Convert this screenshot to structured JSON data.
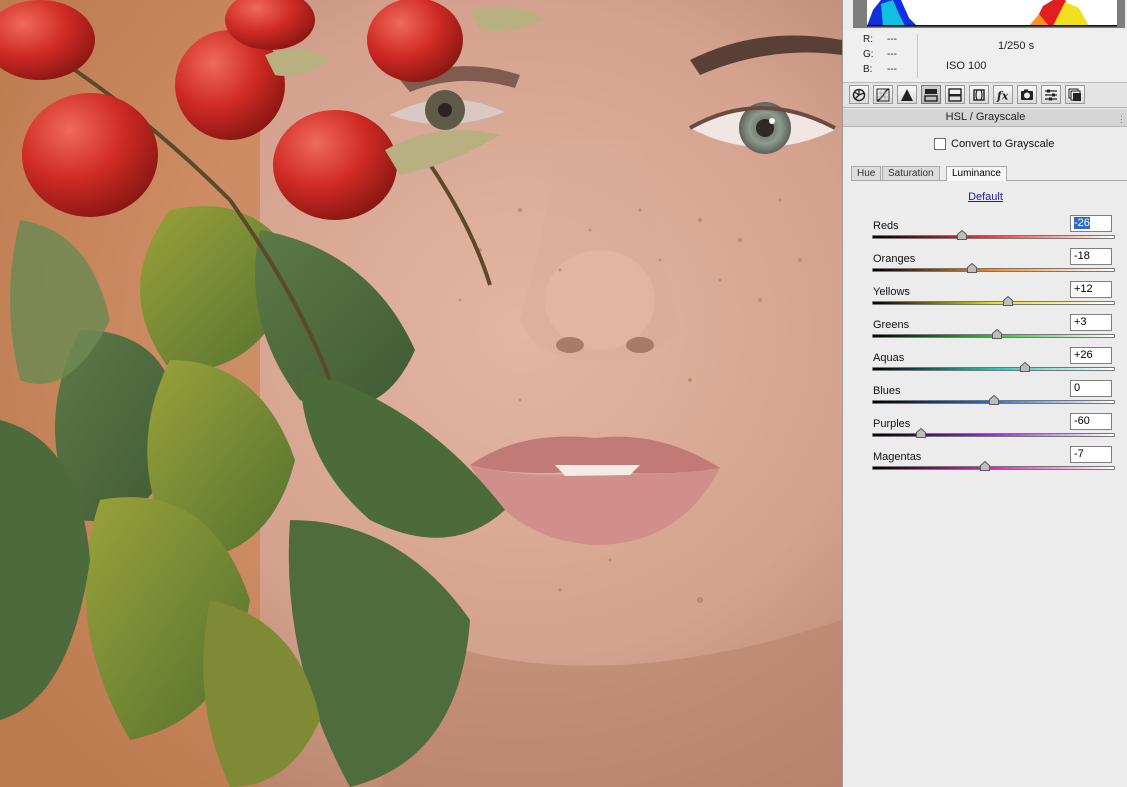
{
  "panel": {
    "rgb": [
      {
        "label": "R:",
        "value": "---"
      },
      {
        "label": "G:",
        "value": "---"
      },
      {
        "label": "B:",
        "value": "---"
      }
    ],
    "shutter": "1/250 s",
    "iso": "ISO 100",
    "toolbar_icons": [
      "basic-icon",
      "tone-curve-icon",
      "detail-icon",
      "hsl-icon",
      "split-toning-icon",
      "lens-corrections-icon",
      "fx-icon",
      "camera-calibration-icon",
      "presets-icon",
      "snapshots-icon"
    ],
    "section_title": "HSL / Grayscale",
    "convert_label": "Convert to Grayscale",
    "tabs": [
      {
        "label": "Hue",
        "active": false
      },
      {
        "label": "Saturation",
        "active": false
      },
      {
        "label": "Luminance",
        "active": true
      }
    ],
    "default_label": "Default",
    "sliders": [
      {
        "label": "Reds",
        "value": "-26",
        "num": -26,
        "colors": [
          "#000000",
          "#ff3a3a",
          "#ffffff"
        ]
      },
      {
        "label": "Oranges",
        "value": "-18",
        "num": -18,
        "colors": [
          "#000000",
          "#ff8a1c",
          "#ffffff"
        ]
      },
      {
        "label": "Yellows",
        "value": "+12",
        "num": 12,
        "colors": [
          "#000000",
          "#e6e01a",
          "#ffffff"
        ]
      },
      {
        "label": "Greens",
        "value": "+3",
        "num": 3,
        "colors": [
          "#000000",
          "#2ec430",
          "#ffffff"
        ]
      },
      {
        "label": "Aquas",
        "value": "+26",
        "num": 26,
        "colors": [
          "#000000",
          "#1fc9c0",
          "#ffffff"
        ]
      },
      {
        "label": "Blues",
        "value": "0",
        "num": 0,
        "colors": [
          "#000000",
          "#2a6fe0",
          "#ffffff"
        ]
      },
      {
        "label": "Purples",
        "value": "-60",
        "num": -60,
        "colors": [
          "#000000",
          "#9a2ee0",
          "#ffffff"
        ]
      },
      {
        "label": "Magentas",
        "value": "-7",
        "num": -7,
        "colors": [
          "#000000",
          "#e02ab0",
          "#ffffff"
        ]
      }
    ],
    "slider_range": [
      -100,
      100
    ]
  }
}
